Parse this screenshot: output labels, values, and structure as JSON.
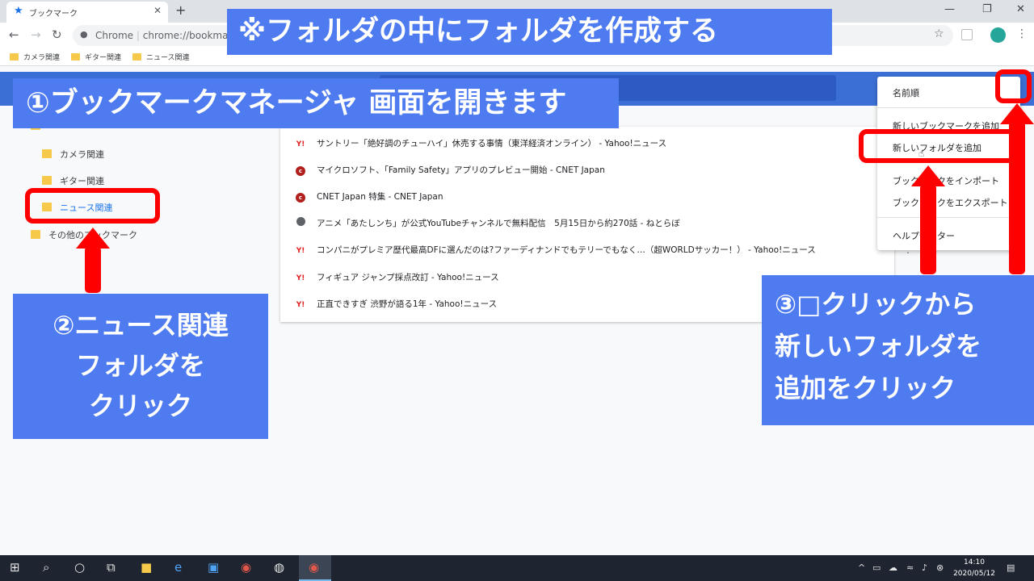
{
  "browser": {
    "tab_title": "ブックマーク",
    "omnibox_chip": "Chrome",
    "url": "chrome://bookmarks",
    "bookmarks_bar": [
      "カメラ関連",
      "ギター関連",
      "ニュース関連"
    ]
  },
  "sidebar": {
    "items": [
      {
        "label": "カメラ関連"
      },
      {
        "label": "ギター関連"
      },
      {
        "label": "ニュース関連"
      },
      {
        "label": "その他のブックマーク"
      }
    ]
  },
  "bookmarks": [
    {
      "icon": "yahoo-icon",
      "title": "サントリー「絶好調のチューハイ」休売する事情（東洋経済オンライン） - Yahoo!ニュース"
    },
    {
      "icon": "cnet-icon",
      "title": "マイクロソフト、「Family Safety」アプリのプレビュー開始 - CNET Japan"
    },
    {
      "icon": "cnet-icon",
      "title": "CNET Japan 特集 - CNET Japan"
    },
    {
      "icon": "globe-icon",
      "title": "アニメ「あたしンち」が公式YouTubeチャンネルで無料配信　5月15日から約270話 - ねとらぼ"
    },
    {
      "icon": "yahoo-icon",
      "title": "コンパニがプレミア歴代最高DFに選んだのは?ファーディナンドでもテリーでもなく…（超WORLDサッカー！） - Yahoo!ニュース"
    },
    {
      "icon": "yahoo-icon",
      "title": "フィギュア ジャンプ採点改訂 - Yahoo!ニュース"
    },
    {
      "icon": "yahoo-icon",
      "title": "正直できすぎ 渋野が語る1年 - Yahoo!ニュース"
    }
  ],
  "menu": {
    "sort": "名前順",
    "add_bookmark": "新しいブックマークを追加",
    "add_folder": "新しいフォルダを追加",
    "import": "ブックマークをインポート",
    "export": "ブックマークをエクスポート",
    "help": "ヘルプセンター"
  },
  "overlay": {
    "top": "※フォルダの中にフォルダを作成する",
    "step1": "①ブックマークマネージャ 画面を開きます",
    "step2": [
      "②ニュース関連",
      "フォルダを",
      "クリック"
    ],
    "step3": [
      "③□クリックから",
      "新しいフォルダを",
      "追加をクリック"
    ]
  },
  "taskbar": {
    "time": "14:10",
    "date": "2020/05/12"
  },
  "colors": {
    "overlay_blue": "#4f7bf0",
    "highlight_red": "#ff0000",
    "header_blue": "#3b6fd6"
  }
}
